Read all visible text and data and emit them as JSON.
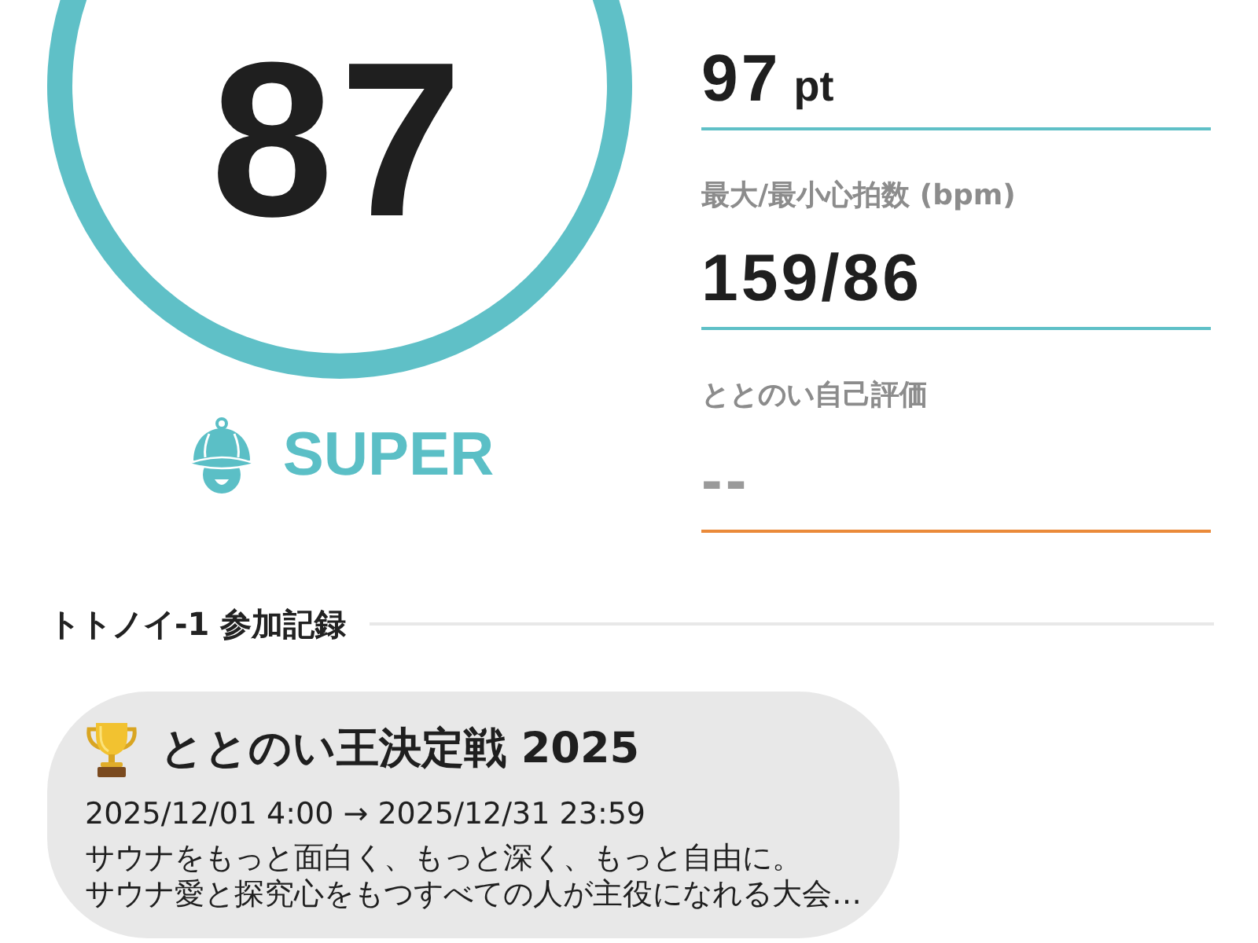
{
  "score": {
    "value": "87",
    "rank": "SUPER"
  },
  "metrics": [
    {
      "kind": "value",
      "value": "97",
      "unit": "pt"
    },
    {
      "kind": "value",
      "label": "最大/最小心拍数 (bpm)",
      "value": "159/86"
    },
    {
      "kind": "input",
      "label": "ととのい自己評価",
      "placeholder": "--"
    }
  ],
  "records": {
    "title": "トトノイ-1 参加記録",
    "items": [
      {
        "title": "ととのい王決定戦 2025",
        "period": "2025/12/01 4:00 → 2025/12/31 23:59",
        "description": "サウナをもっと面白く、もっと深く、もっと自由に。サウナ愛と探究心をもつすべての人が主役になれる大会…"
      }
    ]
  }
}
